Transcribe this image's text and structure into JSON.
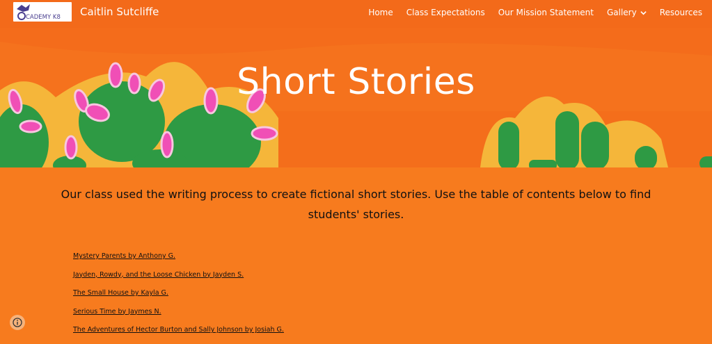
{
  "colors": {
    "background": "#f77b1e",
    "accent_pink": "#f04fb6",
    "cactus_green": "#2e9a44"
  },
  "header": {
    "logo_icon": "academy-k8-dragon-logo",
    "logo_text": "CADEMY K8",
    "site_title": "Caitlin Sutcliffe",
    "nav": [
      {
        "label": "Home"
      },
      {
        "label": "Class Expectations"
      },
      {
        "label": "Our Mission Statement"
      },
      {
        "label": "Gallery",
        "icon": "chevron-down-icon"
      },
      {
        "label": "Resources"
      }
    ]
  },
  "hero": {
    "title": "Short Stories"
  },
  "main": {
    "intro": "Our class used the writing process to create fictional short stories. Use the table of contents below to find students' stories.",
    "stories": [
      "Mystery Parents by Anthony G.",
      "Jayden, Rowdy, and the Loose Chicken by Jayden S.",
      "The Small House by Kayla G.",
      "Serious Time by Jaymes N.",
      "The Adventures of Hector Burton and Sally Johnson by Josiah G."
    ]
  },
  "footer": {
    "info_icon": "info-icon"
  }
}
